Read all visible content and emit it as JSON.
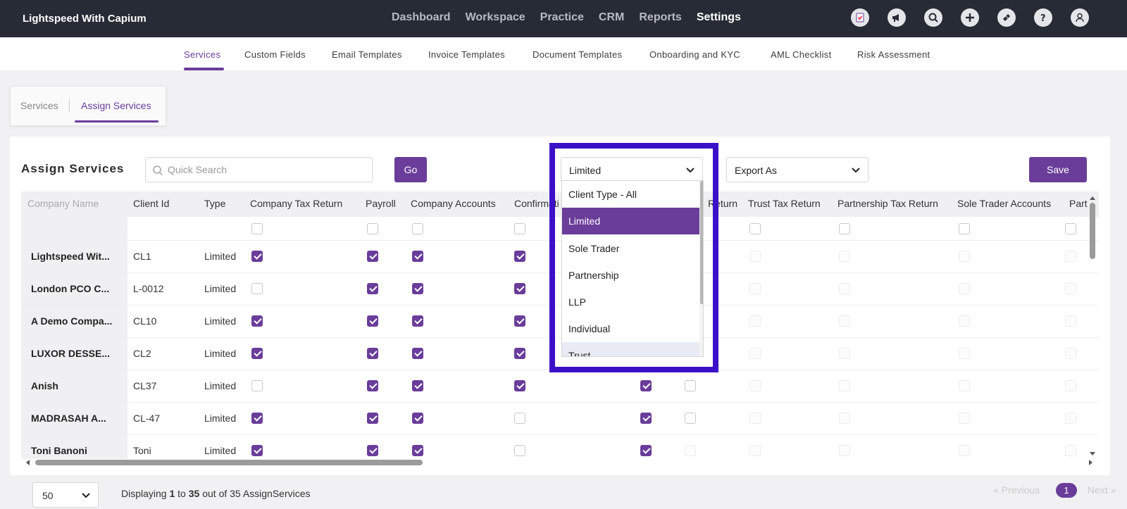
{
  "app": {
    "title": "Lightspeed With Capium"
  },
  "nav": {
    "items": [
      "Dashboard",
      "Workspace",
      "Practice",
      "CRM",
      "Reports",
      "Settings"
    ],
    "active": "Settings"
  },
  "top_icons": [
    "task-icon",
    "megaphone-icon",
    "search-icon",
    "add-icon",
    "ticket-icon",
    "help-icon",
    "user-icon"
  ],
  "subnav": {
    "items": [
      "Services",
      "Custom Fields",
      "Email Templates",
      "Invoice Templates",
      "Document Templates",
      "Onboarding and KYC",
      "AML Checklist",
      "Risk Assessment"
    ],
    "active": "Services"
  },
  "inner_tabs": {
    "items": [
      "Services",
      "Assign Services"
    ],
    "active": "Assign Services"
  },
  "panel": {
    "title": "Assign Services",
    "search_placeholder": "Quick Search",
    "go_label": "Go",
    "client_type_selected": "Limited",
    "export_label": "Export As",
    "save_label": "Save"
  },
  "table": {
    "columns": [
      "Company Name",
      "Client Id",
      "Type",
      "Company Tax Return",
      "Payroll",
      "Company Accounts",
      "Confirmati",
      "Return",
      "Trust Tax Return",
      "Partnership Tax Return",
      "Sole Trader Accounts",
      "Part"
    ],
    "rows": [
      {
        "name": "Lightspeed Wit...",
        "client_id": "CL1",
        "type": "Limited",
        "checks": [
          true,
          true,
          true,
          true,
          null,
          null,
          false,
          false,
          false,
          false
        ]
      },
      {
        "name": "London PCO C...",
        "client_id": "L-0012",
        "type": "Limited",
        "checks": [
          false,
          true,
          true,
          true,
          null,
          null,
          false,
          false,
          false,
          false
        ]
      },
      {
        "name": "A Demo Compa...",
        "client_id": "CL10",
        "type": "Limited",
        "checks": [
          true,
          true,
          true,
          true,
          null,
          null,
          false,
          false,
          false,
          false
        ]
      },
      {
        "name": "LUXOR DESSE...",
        "client_id": "CL2",
        "type": "Limited",
        "checks": [
          true,
          true,
          true,
          true,
          null,
          null,
          false,
          false,
          false,
          false
        ]
      },
      {
        "name": "Anish",
        "client_id": "CL37",
        "type": "Limited",
        "checks": [
          false,
          true,
          true,
          true,
          true,
          false,
          false,
          false,
          false,
          false
        ]
      },
      {
        "name": "MADRASAH A...",
        "client_id": "CL-47",
        "type": "Limited",
        "checks": [
          true,
          true,
          true,
          false,
          true,
          false,
          false,
          false,
          false,
          false
        ]
      },
      {
        "name": "Toni Banoni",
        "client_id": "Toni",
        "type": "Limited",
        "checks": [
          true,
          true,
          true,
          false,
          true,
          false,
          false,
          false,
          false,
          false
        ]
      }
    ]
  },
  "dropdown": {
    "options": [
      "Client Type - All",
      "Limited",
      "Sole Trader",
      "Partnership",
      "LLP",
      "Individual",
      "Trust"
    ],
    "selected": "Limited"
  },
  "footer": {
    "page_size": "50",
    "display_prefix": "Displaying",
    "display_from": "1",
    "display_to_word": "to",
    "display_to": "35",
    "display_suffix": "out of 35 AssignServices",
    "prev_label": "« Previous",
    "page": "1",
    "next_label": "Next »"
  },
  "colors": {
    "accent": "#6a3d9a",
    "topbar": "#262b36",
    "highlight": "#3b10c9"
  }
}
